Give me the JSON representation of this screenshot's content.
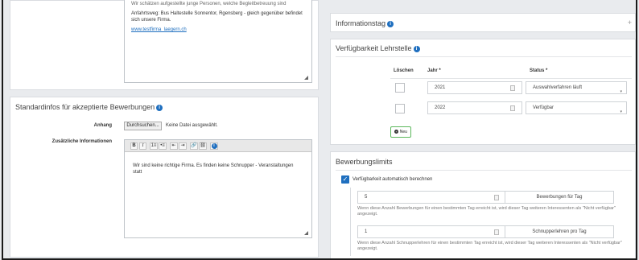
{
  "left_top_editor": {
    "line_cut": "Wir schätzen aufgestellte junge Personen, welche Begleitbetreuung sind",
    "directions": "Anfahrtsweg: Bus Haltestelle Sonnentor, Rgensberg - gleich gegenüber befindet sich unsere Firma.",
    "link": "www.testfirma_laegern.ch"
  },
  "standard_section": {
    "title": "Standardinfos für akzeptierte Bewerbungen",
    "attachment_label": "Anhang",
    "browse_button": "Durchsuchen...",
    "no_file_text": "Keine Datei ausgewählt.",
    "additional_label": "Zusätzliche Informationen",
    "editor_text": "Wir sind keine richtige Firma. Es finden keine  Schnupper - Veranstaltungen statt",
    "toolbar": {
      "bold": "B",
      "italic": "I",
      "ol": "1≡",
      "ul": "•≡",
      "outdent": "⇤",
      "indent": "⇥",
      "link": "🔗",
      "unlink": "⛓",
      "info": "i"
    }
  },
  "info_tag": {
    "title": "Informationstag",
    "expand": "+"
  },
  "availability": {
    "title": "Verfügbarkeit Lehrstelle",
    "headers": {
      "delete": "Löschen",
      "year": "Jahr *",
      "status": "Status *"
    },
    "rows": [
      {
        "year": "2021",
        "status": "Auswahlverfahren läuft"
      },
      {
        "year": "2022",
        "status": "Verfügbar"
      }
    ],
    "new_button": "Neu"
  },
  "limits": {
    "title": "Bewerbungslimits",
    "auto_label": "Verfügbarkeit automatisch berechnen",
    "per_day_value": "5",
    "per_day_label": "Bewerbungen für Tag",
    "per_day_help": "Wenn diese Anzahl Bewerbungen für einen bestimmten Tag erreicht ist, wird dieser Tag weiteren Interessenten als \"Nicht verfügbar\" angezeigt.",
    "trial_value": "1",
    "trial_label": "Schnupperlehren pro Tag",
    "trial_help": "Wenn diese Anzahl Schnupperlehren für einen bestimmten Tag erreicht ist, wird dieser Tag weiteren Interessenten als \"Nicht verfügbar\" angezeigt."
  },
  "colors": {
    "accent": "#1f6fbf",
    "new_border": "#5cb85c"
  }
}
